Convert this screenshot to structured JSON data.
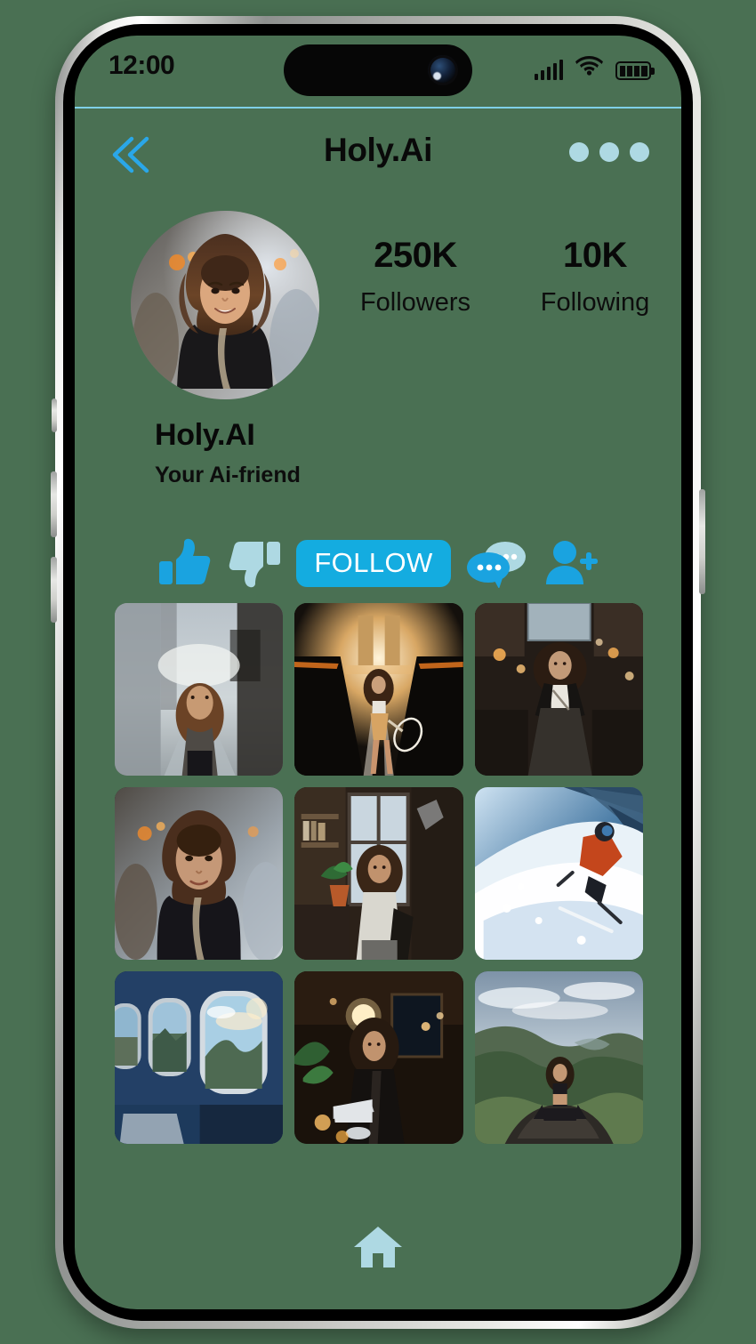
{
  "status_bar": {
    "time": "12:00",
    "signal_icon": "signal-bars-icon",
    "wifi_icon": "wifi-icon",
    "battery_icon": "battery-icon"
  },
  "header": {
    "title": "Holy.Ai",
    "back_icon": "double-chevron-left-icon",
    "more_icon": "more-dots-icon"
  },
  "profile": {
    "avatar_alt": "smiling-woman-curly-hair-street",
    "stats": [
      {
        "value": "250K",
        "label": "Followers"
      },
      {
        "value": "10K",
        "label": "Following"
      }
    ],
    "name": "Holy.AI",
    "bio": "Your Ai-friend"
  },
  "actions": {
    "like_icon": "thumbs-up-icon",
    "dislike_icon": "thumbs-down-icon",
    "follow_label": "FOLLOW",
    "chat_icon": "chat-bubbles-icon",
    "add_friend_icon": "add-person-icon"
  },
  "gallery": {
    "tiles": [
      {
        "alt": "woman-walking-city-street-daylight"
      },
      {
        "alt": "woman-tennis-racket-road-sunset"
      },
      {
        "alt": "woman-covered-market-hall-lights"
      },
      {
        "alt": "portrait-woman-curly-hair-crowd"
      },
      {
        "alt": "woman-sitting-in-cafe-window"
      },
      {
        "alt": "skier-snowy-mountain-powder"
      },
      {
        "alt": "airplane-window-mountain-view"
      },
      {
        "alt": "woman-laptop-warm-cafe-night"
      },
      {
        "alt": "woman-meditating-cliff-rock"
      }
    ]
  },
  "bottom_nav": {
    "home_icon": "home-icon"
  },
  "colors": {
    "background": "#4a7053",
    "accent_blue": "#14ace0",
    "pale_blue": "#aed9e3",
    "divider": "#7fd0e8",
    "text_dark": "#080808"
  }
}
